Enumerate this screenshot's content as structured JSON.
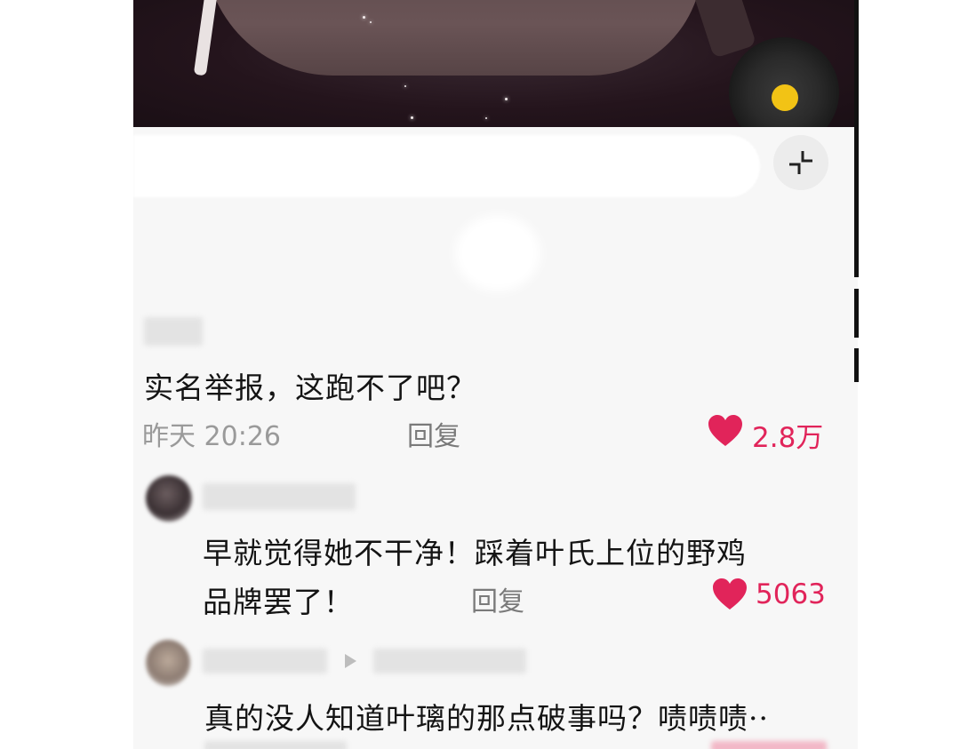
{
  "colors": {
    "like_red": "#e1245a",
    "vinyl_center": "#f2c315",
    "meta_gray": "#9a9a9a"
  },
  "icons": {
    "collapse": "collapse-arrows-icon",
    "like": "heart-icon",
    "reply_arrow": "triangle-right-icon"
  },
  "comments": [
    {
      "text": "实名举报，这跑不了吧？",
      "time": "昨天 20:26",
      "reply_label": "回复",
      "likes": "2.8万"
    },
    {
      "text_line1": "早就觉得她不干净！踩着叶氏上位的野鸡",
      "text_line2": "品牌罢了！",
      "reply_label": "回复",
      "likes": "5063"
    },
    {
      "text": "真的没人知道叶璃的那点破事吗？啧啧啧··"
    }
  ]
}
